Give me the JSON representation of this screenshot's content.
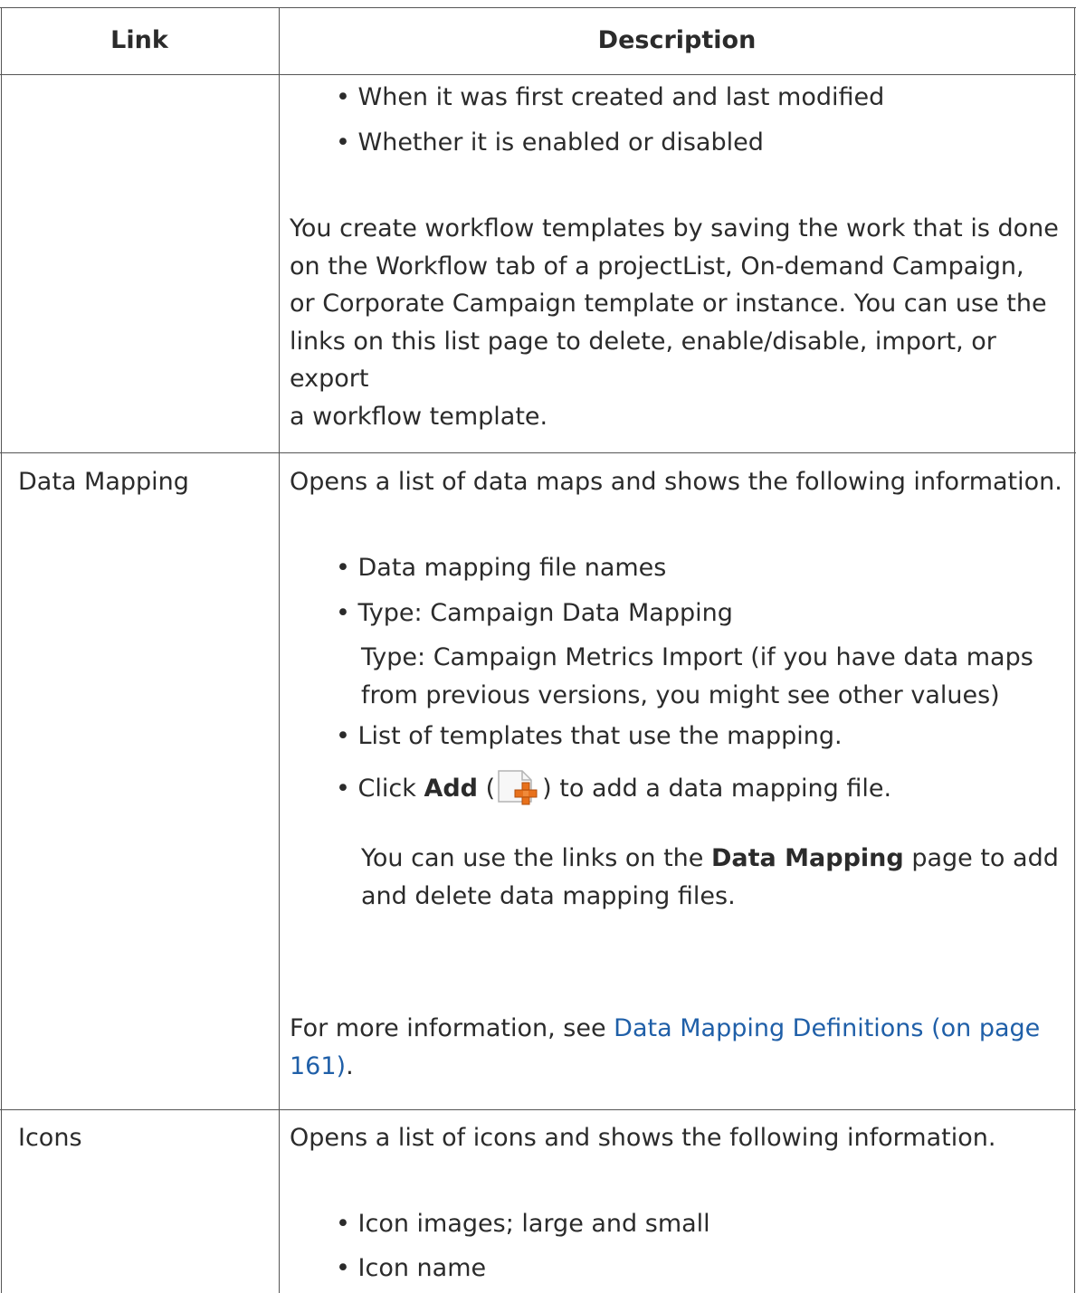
{
  "header": {
    "col_link": "Link",
    "col_description": "Description"
  },
  "row_workflow": {
    "bullets": [
      "When it was first created and last modified",
      "Whether it is enabled or disabled"
    ],
    "paragraph_lines": [
      "You create workflow templates by saving the work that is done",
      "on the Workflow tab of a projectList, On-demand Campaign,",
      "or Corporate Campaign template or instance. You can use the",
      "links on this list page to delete, enable/disable, import, or export",
      "a workflow template."
    ]
  },
  "row_data_mapping": {
    "link": "Data Mapping",
    "intro": "Opens a list of data maps and shows the following information.",
    "bullet1": "Data mapping file names",
    "bullet2": "Type: Campaign Data Mapping",
    "bullet2_sub": [
      "Type: Campaign Metrics Import (if you have data maps",
      "from previous versions, you might see other values)"
    ],
    "bullet3": "List of templates that use the mapping.",
    "bullet4_pre": "Click",
    "bullet4_bold": "Add",
    "bullet4_open": "(",
    "bullet4_post": ") to add a data mapping file.",
    "bullet4_icon": "add-document-icon",
    "note_line1_pre": "You can use the links on the",
    "note_line1_bold": "Data Mapping",
    "note_line1_post": "page to add",
    "note_line2": "and delete data mapping files.",
    "more_pre": "For more information, see",
    "more_link_line1": "Data Mapping Definitions (on page",
    "more_link_line2": "161)",
    "more_end": "."
  },
  "row_icons": {
    "link": "Icons",
    "intro": "Opens a list of icons and shows the following information.",
    "bullets": [
      "Icon images; large and small",
      "Icon name"
    ]
  },
  "colors": {
    "link": "#1f5fa8",
    "icon_orange": "#e8711c"
  }
}
